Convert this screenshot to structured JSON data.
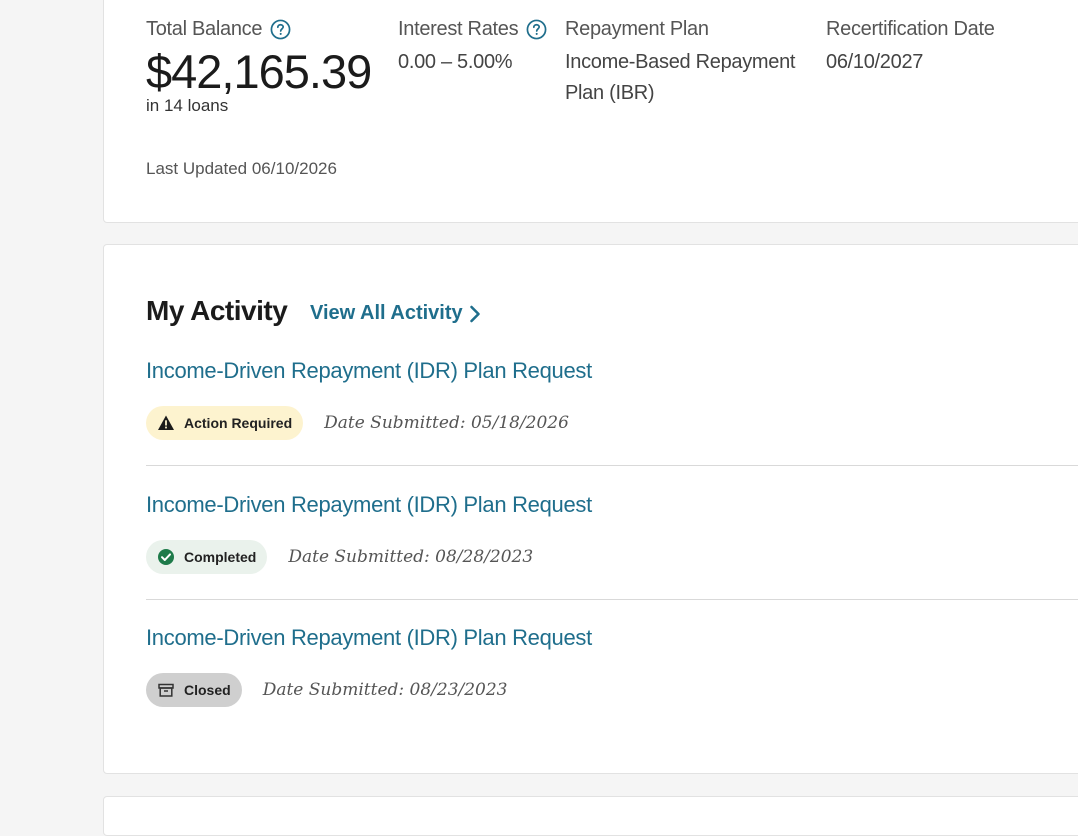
{
  "summary": {
    "total_balance": {
      "label": "Total Balance",
      "value": "$42,165.39",
      "loans_note": "in 14 loans"
    },
    "interest_rates": {
      "label": "Interest Rates",
      "value": "0.00 – 5.00%"
    },
    "repayment_plan": {
      "label": "Repayment Plan",
      "value_line1": "Income-Based Repayment",
      "value_line2": "Plan (IBR)"
    },
    "recertification": {
      "label": "Recertification Date",
      "value": "06/10/2027"
    },
    "last_updated": "Last Updated 06/10/2026"
  },
  "activity": {
    "title": "My Activity",
    "view_all_label": "View All Activity",
    "items": [
      {
        "title": "Income-Driven Repayment (IDR) Plan Request",
        "status": "Action Required",
        "date_submitted": "Date Submitted: 05/18/2026"
      },
      {
        "title": "Income-Driven Repayment (IDR) Plan Request",
        "status": "Completed",
        "date_submitted": "Date Submitted: 08/28/2023"
      },
      {
        "title": "Income-Driven Repayment (IDR) Plan Request",
        "status": "Closed",
        "date_submitted": "Date Submitted: 08/23/2023"
      }
    ]
  },
  "colors": {
    "link": "#1f6e8c",
    "action_required_bg": "#fdf3cf",
    "completed_bg": "#eaf2ec",
    "completed_icon": "#1e7b4a",
    "closed_bg": "#cfcfcf"
  },
  "icons": {
    "help": "question-circle-icon",
    "view_all": "chevron-right-icon",
    "action_required": "warning-triangle-icon",
    "completed": "check-circle-icon",
    "closed": "archive-box-icon"
  }
}
